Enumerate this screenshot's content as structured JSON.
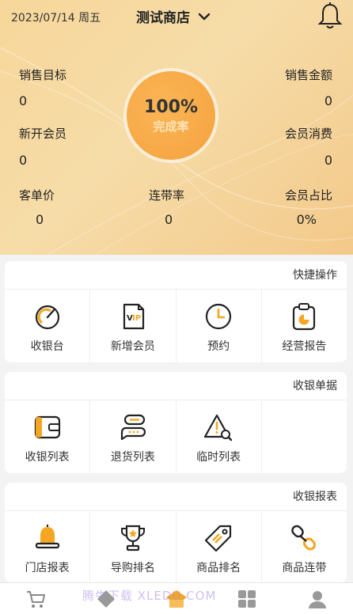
{
  "header": {
    "date": "2023/07/14 周五",
    "store_name": "测试商店"
  },
  "stats": {
    "sales_target_label": "销售目标",
    "sales_target_value": "0",
    "sales_amount_label": "销售金额",
    "sales_amount_value": "0",
    "new_members_label": "新开会员",
    "new_members_value": "0",
    "member_spend_label": "会员消费",
    "member_spend_value": "0",
    "avg_ticket_label": "客单价",
    "avg_ticket_value": "0",
    "attach_rate_label": "连带率",
    "attach_rate_value": "0",
    "member_ratio_label": "会员占比",
    "member_ratio_value": "0%",
    "completion_pct": "100%",
    "completion_label": "完成率"
  },
  "quick_ops": {
    "title": "快捷操作",
    "items": [
      {
        "label": "收银台",
        "icon": "gauge-icon"
      },
      {
        "label": "新增会员",
        "icon": "vip-card-icon"
      },
      {
        "label": "预约",
        "icon": "clock-icon"
      },
      {
        "label": "经营报告",
        "icon": "report-clipboard-icon"
      }
    ]
  },
  "receipts": {
    "title": "收银单据",
    "items": [
      {
        "label": "收银列表",
        "icon": "wallet-icon"
      },
      {
        "label": "退货列表",
        "icon": "return-chat-icon"
      },
      {
        "label": "临时列表",
        "icon": "warning-search-icon"
      }
    ]
  },
  "reports": {
    "title": "收银报表",
    "items": [
      {
        "label": "门店报表",
        "icon": "bell-report-icon"
      },
      {
        "label": "导购排名",
        "icon": "trophy-icon"
      },
      {
        "label": "商品排名",
        "icon": "tag-icon"
      },
      {
        "label": "商品连带",
        "icon": "link-icon"
      }
    ]
  },
  "bottom_nav": {
    "watermark": "腾牛下载 XLEDU.COM",
    "items": [
      "cart-icon",
      "diamond-icon",
      "home-icon",
      "apps-icon",
      "user-icon"
    ]
  },
  "colors": {
    "accent": "#f5a23e",
    "hero_bg": "#f6dca8",
    "icon_orange": "#f5a623"
  }
}
